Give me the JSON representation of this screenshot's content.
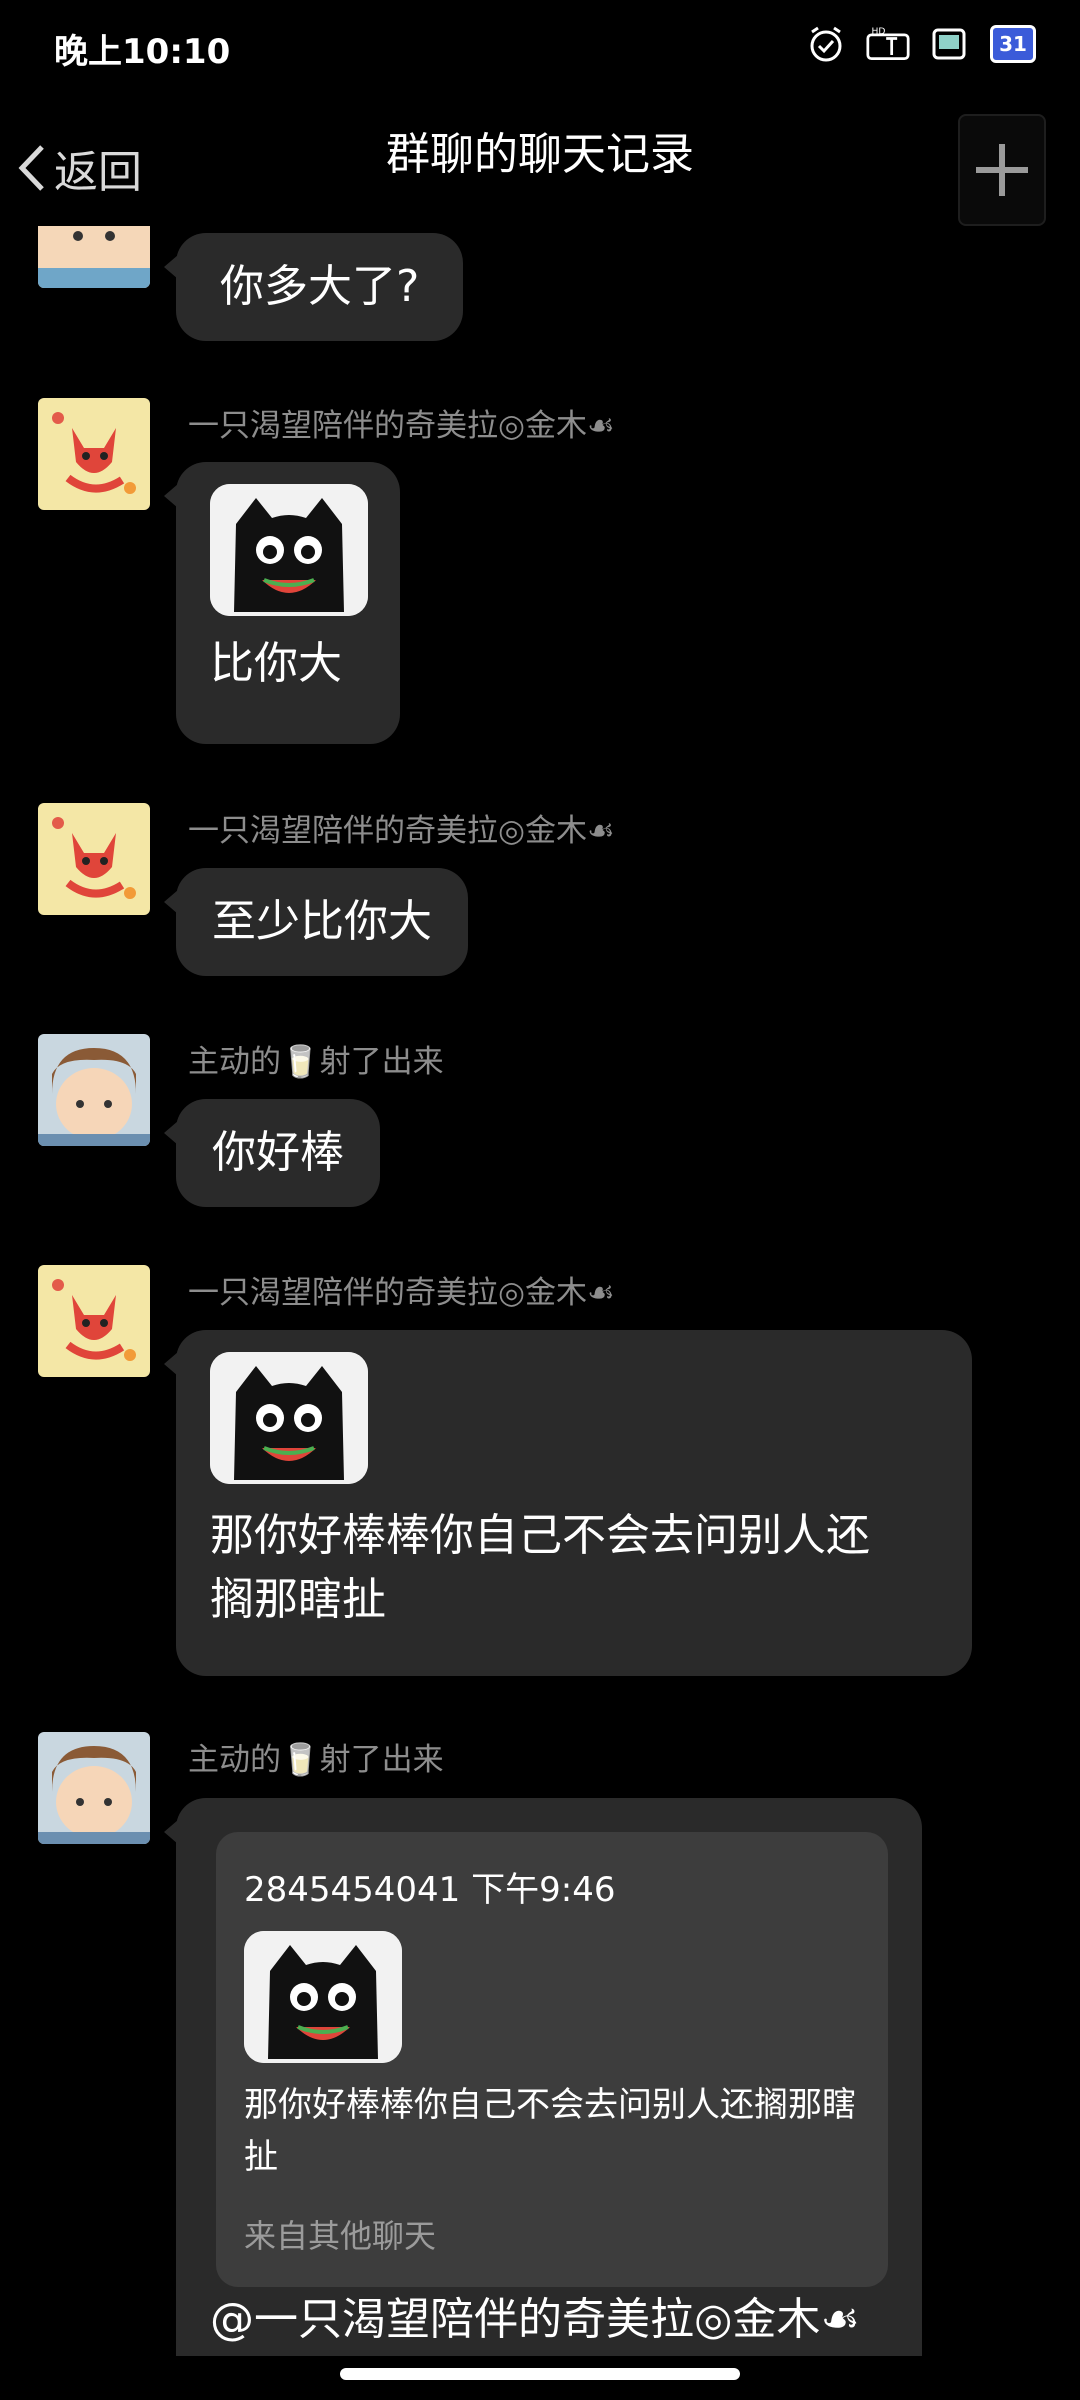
{
  "status_bar": {
    "time": "晚上10:10",
    "icons": [
      "alarm-icon",
      "hd-signal-icon",
      "battery-icon",
      "calendar-icon"
    ],
    "calendar_day": "31"
  },
  "header": {
    "back_label": "返回",
    "title": "群聊的聊天记录"
  },
  "messages": {
    "m0": {
      "text": "你多大了?"
    },
    "m1": {
      "sender": "一只渴望陪伴的奇美拉◎金木☙",
      "text": "比你大"
    },
    "m2": {
      "sender": "一只渴望陪伴的奇美拉◎金木☙",
      "text": "至少比你大"
    },
    "m3": {
      "sender": "主动的🥛射了出来",
      "text": "你好棒"
    },
    "m4": {
      "sender": "一只渴望陪伴的奇美拉◎金木☙",
      "text": "那你好棒棒你自己不会去问别人还搁那瞎扯"
    },
    "m5": {
      "sender": "主动的🥛射了出来",
      "quote_head": "2845454041 下午9:46",
      "quote_text": "那你好棒棒你自己不会去问别人还搁那瞎扯",
      "quote_source": "来自其他聊天",
      "text": "@一只渴望陪伴的奇美拉◎金木☙ @一只渴望陪伴的奇美拉◎金"
    }
  },
  "colors": {
    "background": "#000000",
    "bubble": "#2a2a2a",
    "quote_card": "#3d3d3d",
    "sender_text": "#8d8d8d"
  }
}
